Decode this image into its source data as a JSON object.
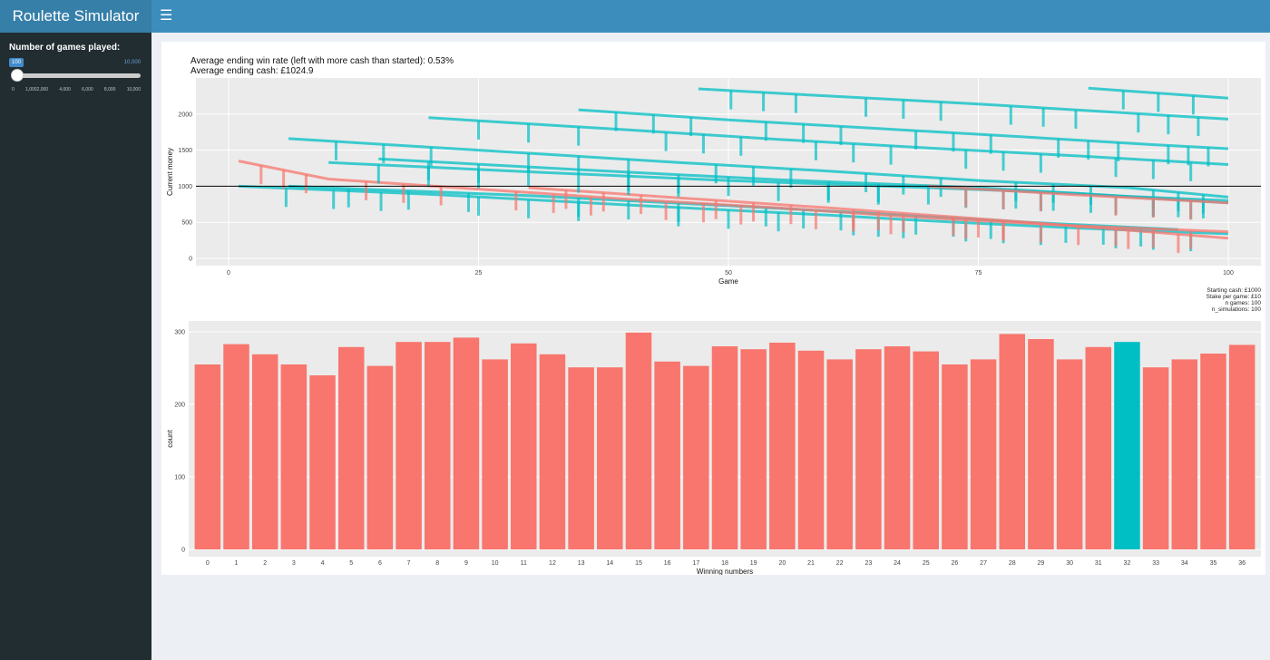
{
  "header": {
    "title": "Roulette Simulator",
    "toggle_icon": "menu-icon"
  },
  "sidebar": {
    "slider_label": "Number of games played:",
    "slider_value": "100",
    "slider_max_label": "10,000",
    "slider_fraction": 0.01,
    "slider_ticks": [
      "0",
      "1,0002,000",
      "4,000",
      "6,000",
      "8,000",
      "10,000"
    ]
  },
  "stats": {
    "win_rate": "Average ending win rate (left with more cash than started): 0.53%",
    "avg_cash": "Average ending cash: £1024.9"
  },
  "caption": [
    "Starting cash: £1000",
    "Stake per game: £10",
    "n games: 100",
    "n_simulations: 100"
  ],
  "colors": {
    "win": "#00bfc4",
    "loss": "#f8766d",
    "accent": "#3c8dbc",
    "sidebar": "#222d32"
  },
  "chart_data": [
    {
      "type": "line",
      "title": "",
      "xlabel": "Game",
      "ylabel": "Current money",
      "xlim": [
        0,
        100
      ],
      "ylim": [
        0,
        2400
      ],
      "x_ticks": [
        "0",
        "25",
        "50",
        "75",
        "100"
      ],
      "y_ticks": [
        "0",
        "500",
        "1000",
        "1500",
        "2000"
      ],
      "hline": 1000,
      "grid": true,
      "series": [
        {
          "color": "#00bfc4",
          "points": [
            [
              1,
              1000
            ],
            [
              20,
              890
            ],
            [
              40,
              740
            ],
            [
              60,
              600
            ],
            [
              70,
              520
            ],
            [
              85,
              420
            ],
            [
              100,
              340
            ]
          ]
        },
        {
          "color": "#00bfc4",
          "points": [
            [
              6,
              1000
            ],
            [
              30,
              870
            ],
            [
              50,
              730
            ],
            [
              65,
              620
            ],
            [
              80,
              500
            ],
            [
              95,
              400
            ]
          ]
        },
        {
          "color": "#f8766d",
          "points": [
            [
              1,
              1350
            ],
            [
              10,
              1100
            ],
            [
              25,
              960
            ],
            [
              40,
              820
            ],
            [
              55,
              700
            ],
            [
              70,
              560
            ],
            [
              85,
              450
            ],
            [
              100,
              370
            ]
          ]
        },
        {
          "color": "#f8766d",
          "points": [
            [
              30,
              980
            ],
            [
              45,
              840
            ],
            [
              60,
              700
            ],
            [
              70,
              600
            ],
            [
              80,
              500
            ],
            [
              100,
              280
            ]
          ]
        },
        {
          "color": "#00bfc4",
          "points": [
            [
              6,
              1660
            ],
            [
              25,
              1500
            ],
            [
              45,
              1330
            ],
            [
              60,
              1210
            ],
            [
              75,
              1080
            ],
            [
              90,
              980
            ],
            [
              100,
              850
            ]
          ]
        },
        {
          "color": "#00bfc4",
          "points": [
            [
              20,
              1950
            ],
            [
              40,
              1780
            ],
            [
              55,
              1650
            ],
            [
              70,
              1530
            ],
            [
              85,
              1420
            ],
            [
              100,
              1300
            ]
          ]
        },
        {
          "color": "#00bfc4",
          "points": [
            [
              35,
              2060
            ],
            [
              50,
              1920
            ],
            [
              65,
              1800
            ],
            [
              80,
              1680
            ],
            [
              92,
              1580
            ],
            [
              100,
              1520
            ]
          ]
        },
        {
          "color": "#00bfc4",
          "points": [
            [
              47,
              2350
            ],
            [
              60,
              2250
            ],
            [
              75,
              2140
            ],
            [
              88,
              2030
            ],
            [
              100,
              1930
            ]
          ]
        },
        {
          "color": "#00bfc4",
          "points": [
            [
              86,
              2360
            ],
            [
              100,
              2220
            ]
          ]
        },
        {
          "color": "#00bfc4",
          "points": [
            [
              10,
              1330
            ],
            [
              30,
              1200
            ],
            [
              50,
              1080
            ],
            [
              70,
              980
            ],
            [
              85,
              900
            ],
            [
              100,
              770
            ]
          ]
        },
        {
          "color": "#00bfc4",
          "points": [
            [
              15,
              1380
            ],
            [
              35,
              1230
            ],
            [
              55,
              1090
            ],
            [
              75,
              980
            ],
            [
              90,
              860
            ],
            [
              100,
              800
            ]
          ]
        },
        {
          "color": "#f8766d",
          "points": [
            [
              70,
              1000
            ],
            [
              85,
              880
            ],
            [
              100,
              770
            ]
          ]
        }
      ]
    },
    {
      "type": "bar",
      "title": "",
      "xlabel": "Winning numbers",
      "ylabel": "count",
      "ylim": [
        0,
        310
      ],
      "y_ticks": [
        "0",
        "100",
        "200",
        "300"
      ],
      "grid": true,
      "categories": [
        "0",
        "1",
        "2",
        "3",
        "4",
        "5",
        "6",
        "7",
        "8",
        "9",
        "10",
        "11",
        "12",
        "13",
        "14",
        "15",
        "16",
        "17",
        "18",
        "19",
        "20",
        "21",
        "22",
        "23",
        "24",
        "25",
        "26",
        "27",
        "28",
        "29",
        "30",
        "31",
        "32",
        "33",
        "34",
        "35",
        "36"
      ],
      "values": [
        255,
        283,
        269,
        255,
        240,
        279,
        253,
        286,
        286,
        292,
        262,
        284,
        269,
        251,
        251,
        299,
        259,
        253,
        280,
        276,
        285,
        274,
        262,
        276,
        280,
        273,
        255,
        262,
        297,
        290,
        262,
        279,
        286,
        251,
        262,
        270,
        282
      ],
      "highlight": "32",
      "bar_color": "#f8766d",
      "highlight_color": "#00bfc4"
    }
  ]
}
